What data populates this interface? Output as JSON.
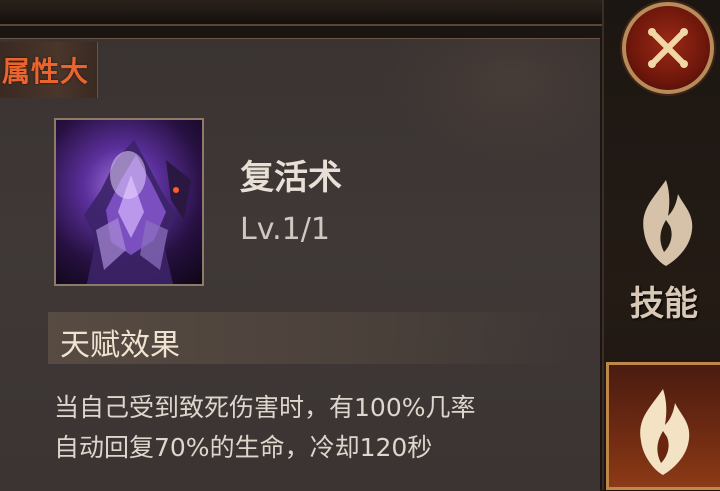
{
  "header": {
    "title_fragment": "属性大"
  },
  "skill": {
    "name": "复活术",
    "level": "Lv.1/1"
  },
  "effect": {
    "heading": "天赋效果",
    "lines": [
      "当自己受到致死伤害时，有100%几率",
      "自动回复70%的生命，冷却120秒"
    ]
  },
  "sidebar": {
    "close_icon": "close-x-icon",
    "tabs": [
      {
        "label": "技能",
        "icon": "flame-icon",
        "active": false
      },
      {
        "label": "",
        "icon": "flame-icon",
        "active": true
      }
    ]
  },
  "colors": {
    "title_orange": "#e8652f",
    "panel_bg": "#3d3634",
    "text_light": "#ddd6cc",
    "accent_gold": "#c0874a"
  }
}
